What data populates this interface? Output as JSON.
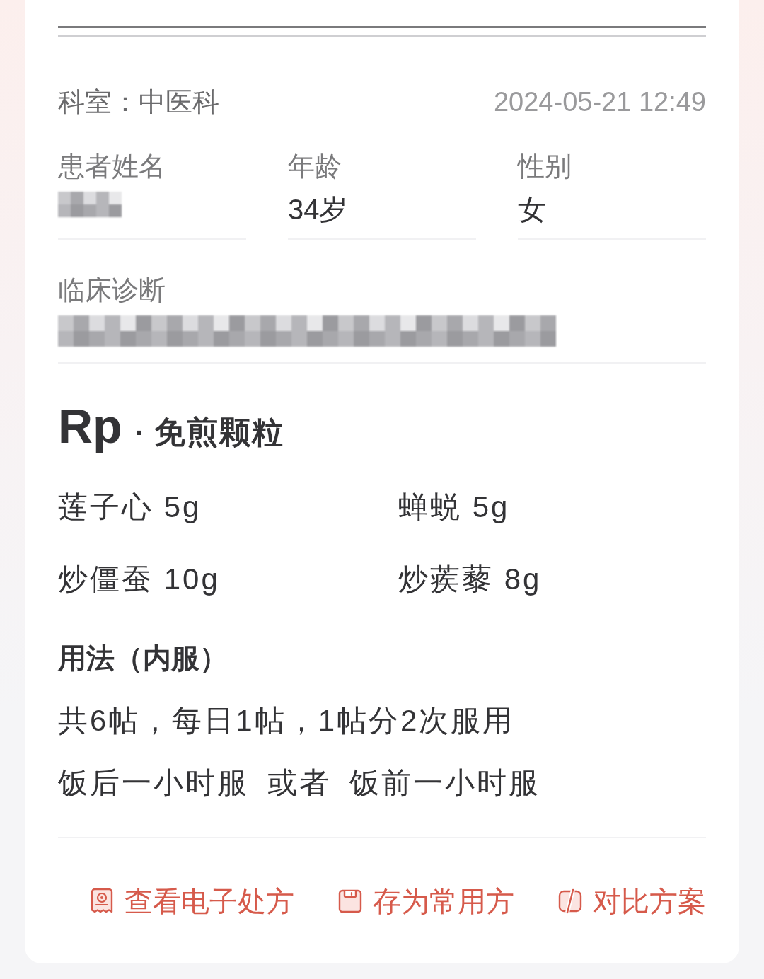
{
  "department": "科室：中医科",
  "datetime": "2024-05-21 12:49",
  "patient_fields": [
    {
      "label": "患者姓名",
      "redacted": true
    },
    {
      "label": "年龄",
      "value": "34岁",
      "redacted": false
    },
    {
      "label": "性别",
      "value": "女",
      "redacted": false
    }
  ],
  "diagnosis": {
    "label": "临床诊断",
    "redacted": true
  },
  "prescription": {
    "title": "Rp",
    "separator": "·",
    "type": "免煎颗粒"
  },
  "herbs": [
    "莲子心 5g",
    "蝉蜕 5g",
    "炒僵蚕 10g",
    "炒蒺藜 8g"
  ],
  "usage": {
    "title": "用法（内服）",
    "dosage": "共6帖，每日1帖，1帖分2次服用",
    "timing": [
      "饭后一小时服",
      "或者",
      "饭前一小时服"
    ]
  },
  "actions": [
    {
      "kind": "prescription",
      "label": "查看电子处方"
    },
    {
      "kind": "save",
      "label": "存为常用方"
    },
    {
      "kind": "compare",
      "label": "对比方案"
    }
  ]
}
